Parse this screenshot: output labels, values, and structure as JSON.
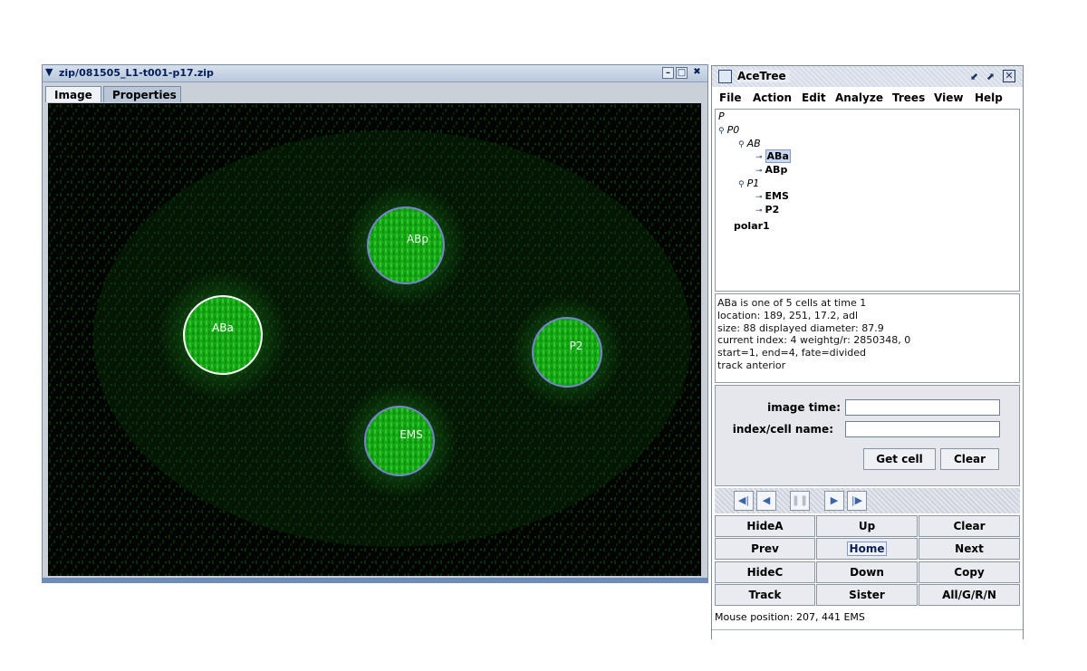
{
  "image_window": {
    "title": "zip/081505_L1-t001-p17.zip",
    "tabs": [
      "Image",
      "Properties"
    ],
    "cells": [
      {
        "label": "ABa",
        "selected": true
      },
      {
        "label": "ABp",
        "selected": false
      },
      {
        "label": "P2",
        "selected": false
      },
      {
        "label": "EMS",
        "selected": false
      }
    ],
    "colors": {
      "signal": "#22c81e",
      "ring": "#7b7fd6",
      "selected_ring": "#ffffff",
      "background": "#020402"
    }
  },
  "acetree": {
    "title": "AceTree",
    "menu": [
      "File",
      "Action",
      "Edit",
      "Analyze",
      "Trees",
      "View",
      "Help"
    ],
    "tree": {
      "root": "P",
      "p0": "P0",
      "ab": "AB",
      "aba": "ABa",
      "abp": "ABp",
      "p1": "P1",
      "ems": "EMS",
      "p2": "P2",
      "polar": "polar1"
    },
    "info_lines": [
      "ABa is one of 5 cells at time 1",
      "location: 189, 251, 17.2, adl",
      "size: 88 displayed diameter: 87.9",
      "current index: 4 weightg/r: 2850348, 0",
      "start=1, end=4, fate=divided",
      "track anterior"
    ],
    "form": {
      "image_time_label": "image time:",
      "image_time_value": "",
      "cell_name_label": "index/cell name:",
      "cell_name_value": "",
      "get_cell": "Get cell",
      "clear": "Clear"
    },
    "nav_icons": [
      "step-back-icon",
      "play-back-icon",
      "pause-icon",
      "play-forward-icon",
      "step-forward-icon"
    ],
    "buttons": [
      [
        "HideA",
        "Up",
        "Clear"
      ],
      [
        "Prev",
        "Home",
        "Next"
      ],
      [
        "HideC",
        "Down",
        "Copy"
      ],
      [
        "Track",
        "Sister",
        "All/G/R/N"
      ]
    ],
    "status": "Mouse position: 207, 441   EMS"
  }
}
